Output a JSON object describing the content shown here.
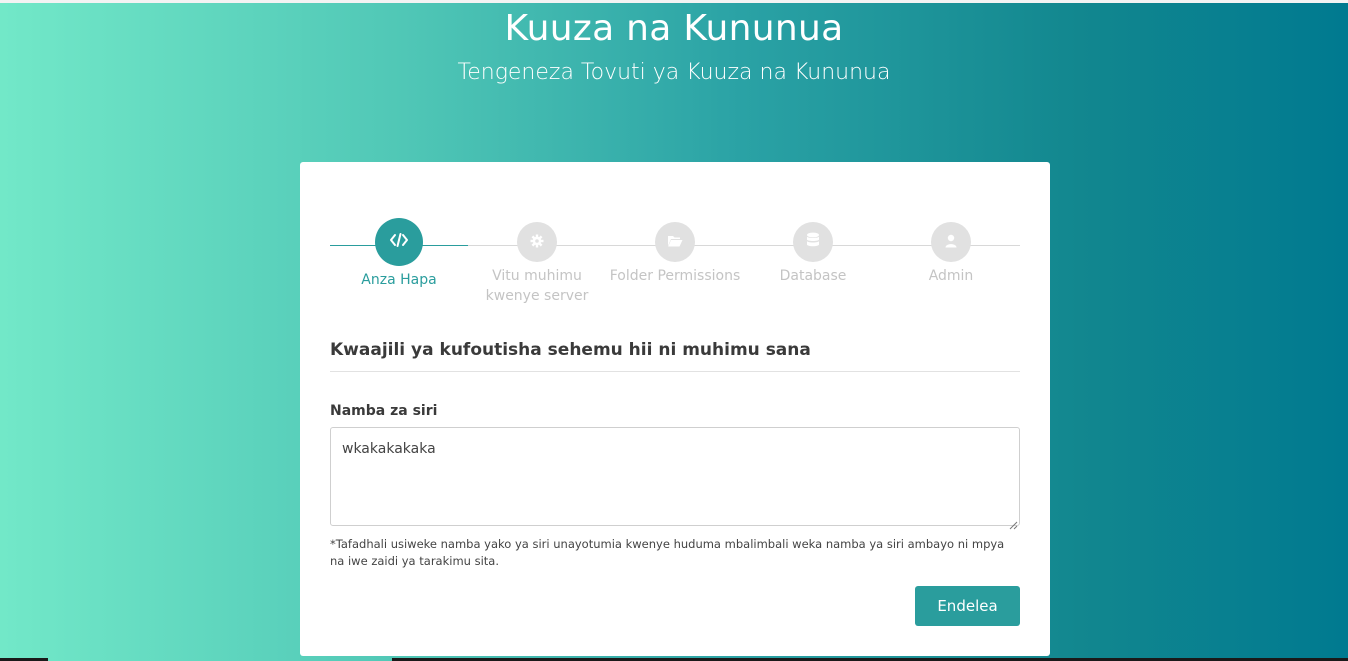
{
  "header": {
    "title": "Kuuza na Kununua",
    "subtitle": "Tengeneza Tovuti ya Kuuza na Kununua"
  },
  "steps": [
    {
      "label": "Anza Hapa",
      "icon": "code-icon",
      "active": true
    },
    {
      "label": "Vitu muhimu kwenye server",
      "icon": "gear-icon",
      "active": false
    },
    {
      "label": "Folder Permissions",
      "icon": "folder-open-icon",
      "active": false
    },
    {
      "label": "Database",
      "icon": "database-icon",
      "active": false
    },
    {
      "label": "Admin",
      "icon": "user-icon",
      "active": false
    }
  ],
  "form": {
    "section_title": "Kwaajili ya kufoutisha sehemu hii ni muhimu sana",
    "field_label": "Namba za siri",
    "field_value": "wkakakakaka",
    "hint": "*Tafadhali usiweke namba yako ya siri unayotumia kwenye huduma mbalimbali weka namba ya siri ambayo ni mpya na iwe zaidi ya tarakimu sita.",
    "submit_label": "Endelea"
  },
  "colors": {
    "accent": "#2a9d9d",
    "inactive": "#e1e1e1",
    "gradient_start": "#72e8c8",
    "gradient_end": "#007a90"
  }
}
